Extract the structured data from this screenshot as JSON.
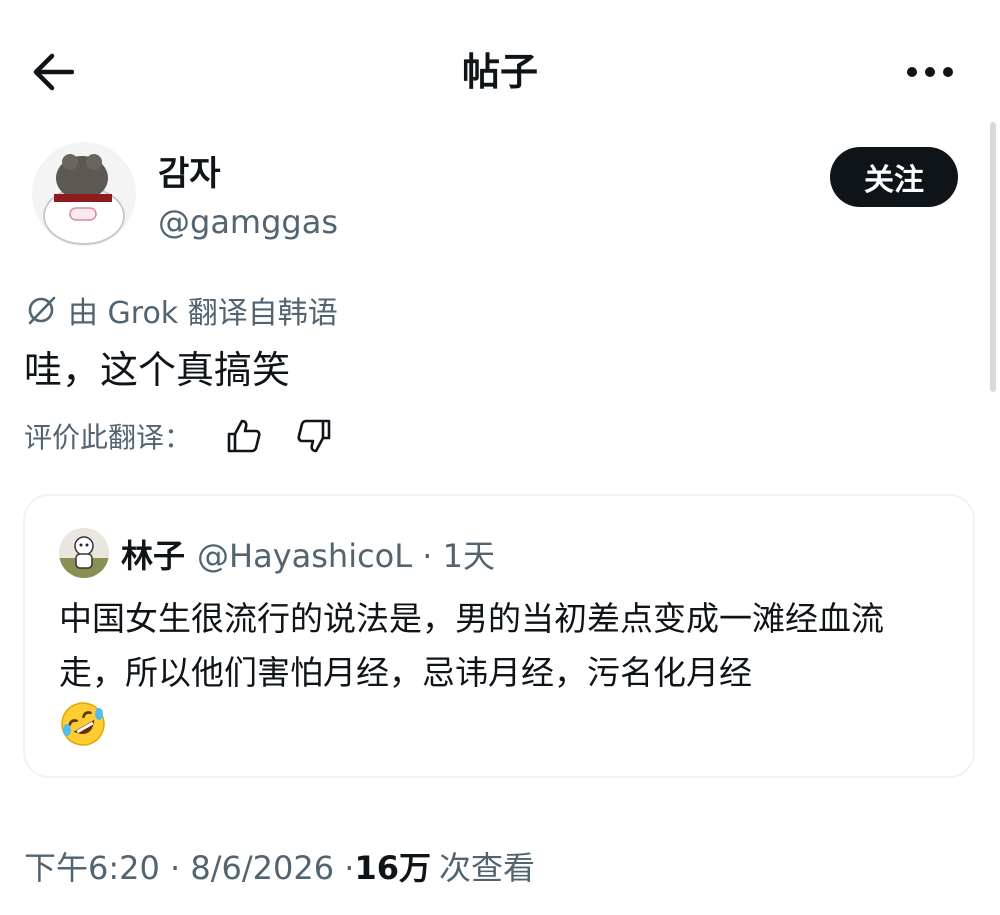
{
  "header": {
    "title": "帖子",
    "back_icon": "arrow-left-icon",
    "more_icon": "more-horizontal-icon"
  },
  "author": {
    "name": "감자",
    "handle": "@gamggas",
    "follow_label": "关注"
  },
  "translation": {
    "notice_prefix": "由 Grok 翻译自韩语",
    "text": "哇，这个真搞笑",
    "rate_label": "评价此翻译：",
    "icons": [
      "grok-icon",
      "thumbs-up-icon",
      "thumbs-down-icon"
    ]
  },
  "quote": {
    "name": "林子",
    "handle_time": "@HayashicoL · 1天",
    "body": "中国女生很流行的说法是，男的当初差点变成一滩经血流走，所以他们害怕月经，忌讳月经，污名化月经",
    "emoji_icon": "rofl-emoji-icon"
  },
  "footer": {
    "time_date": "下午6:20 · 8/6/2026 · ",
    "views": "16万",
    "views_suffix": "次查看"
  },
  "colors": {
    "text": "#0f1419",
    "secondary": "#536471",
    "border": "#eff3f4",
    "button_bg": "#0f1419"
  }
}
